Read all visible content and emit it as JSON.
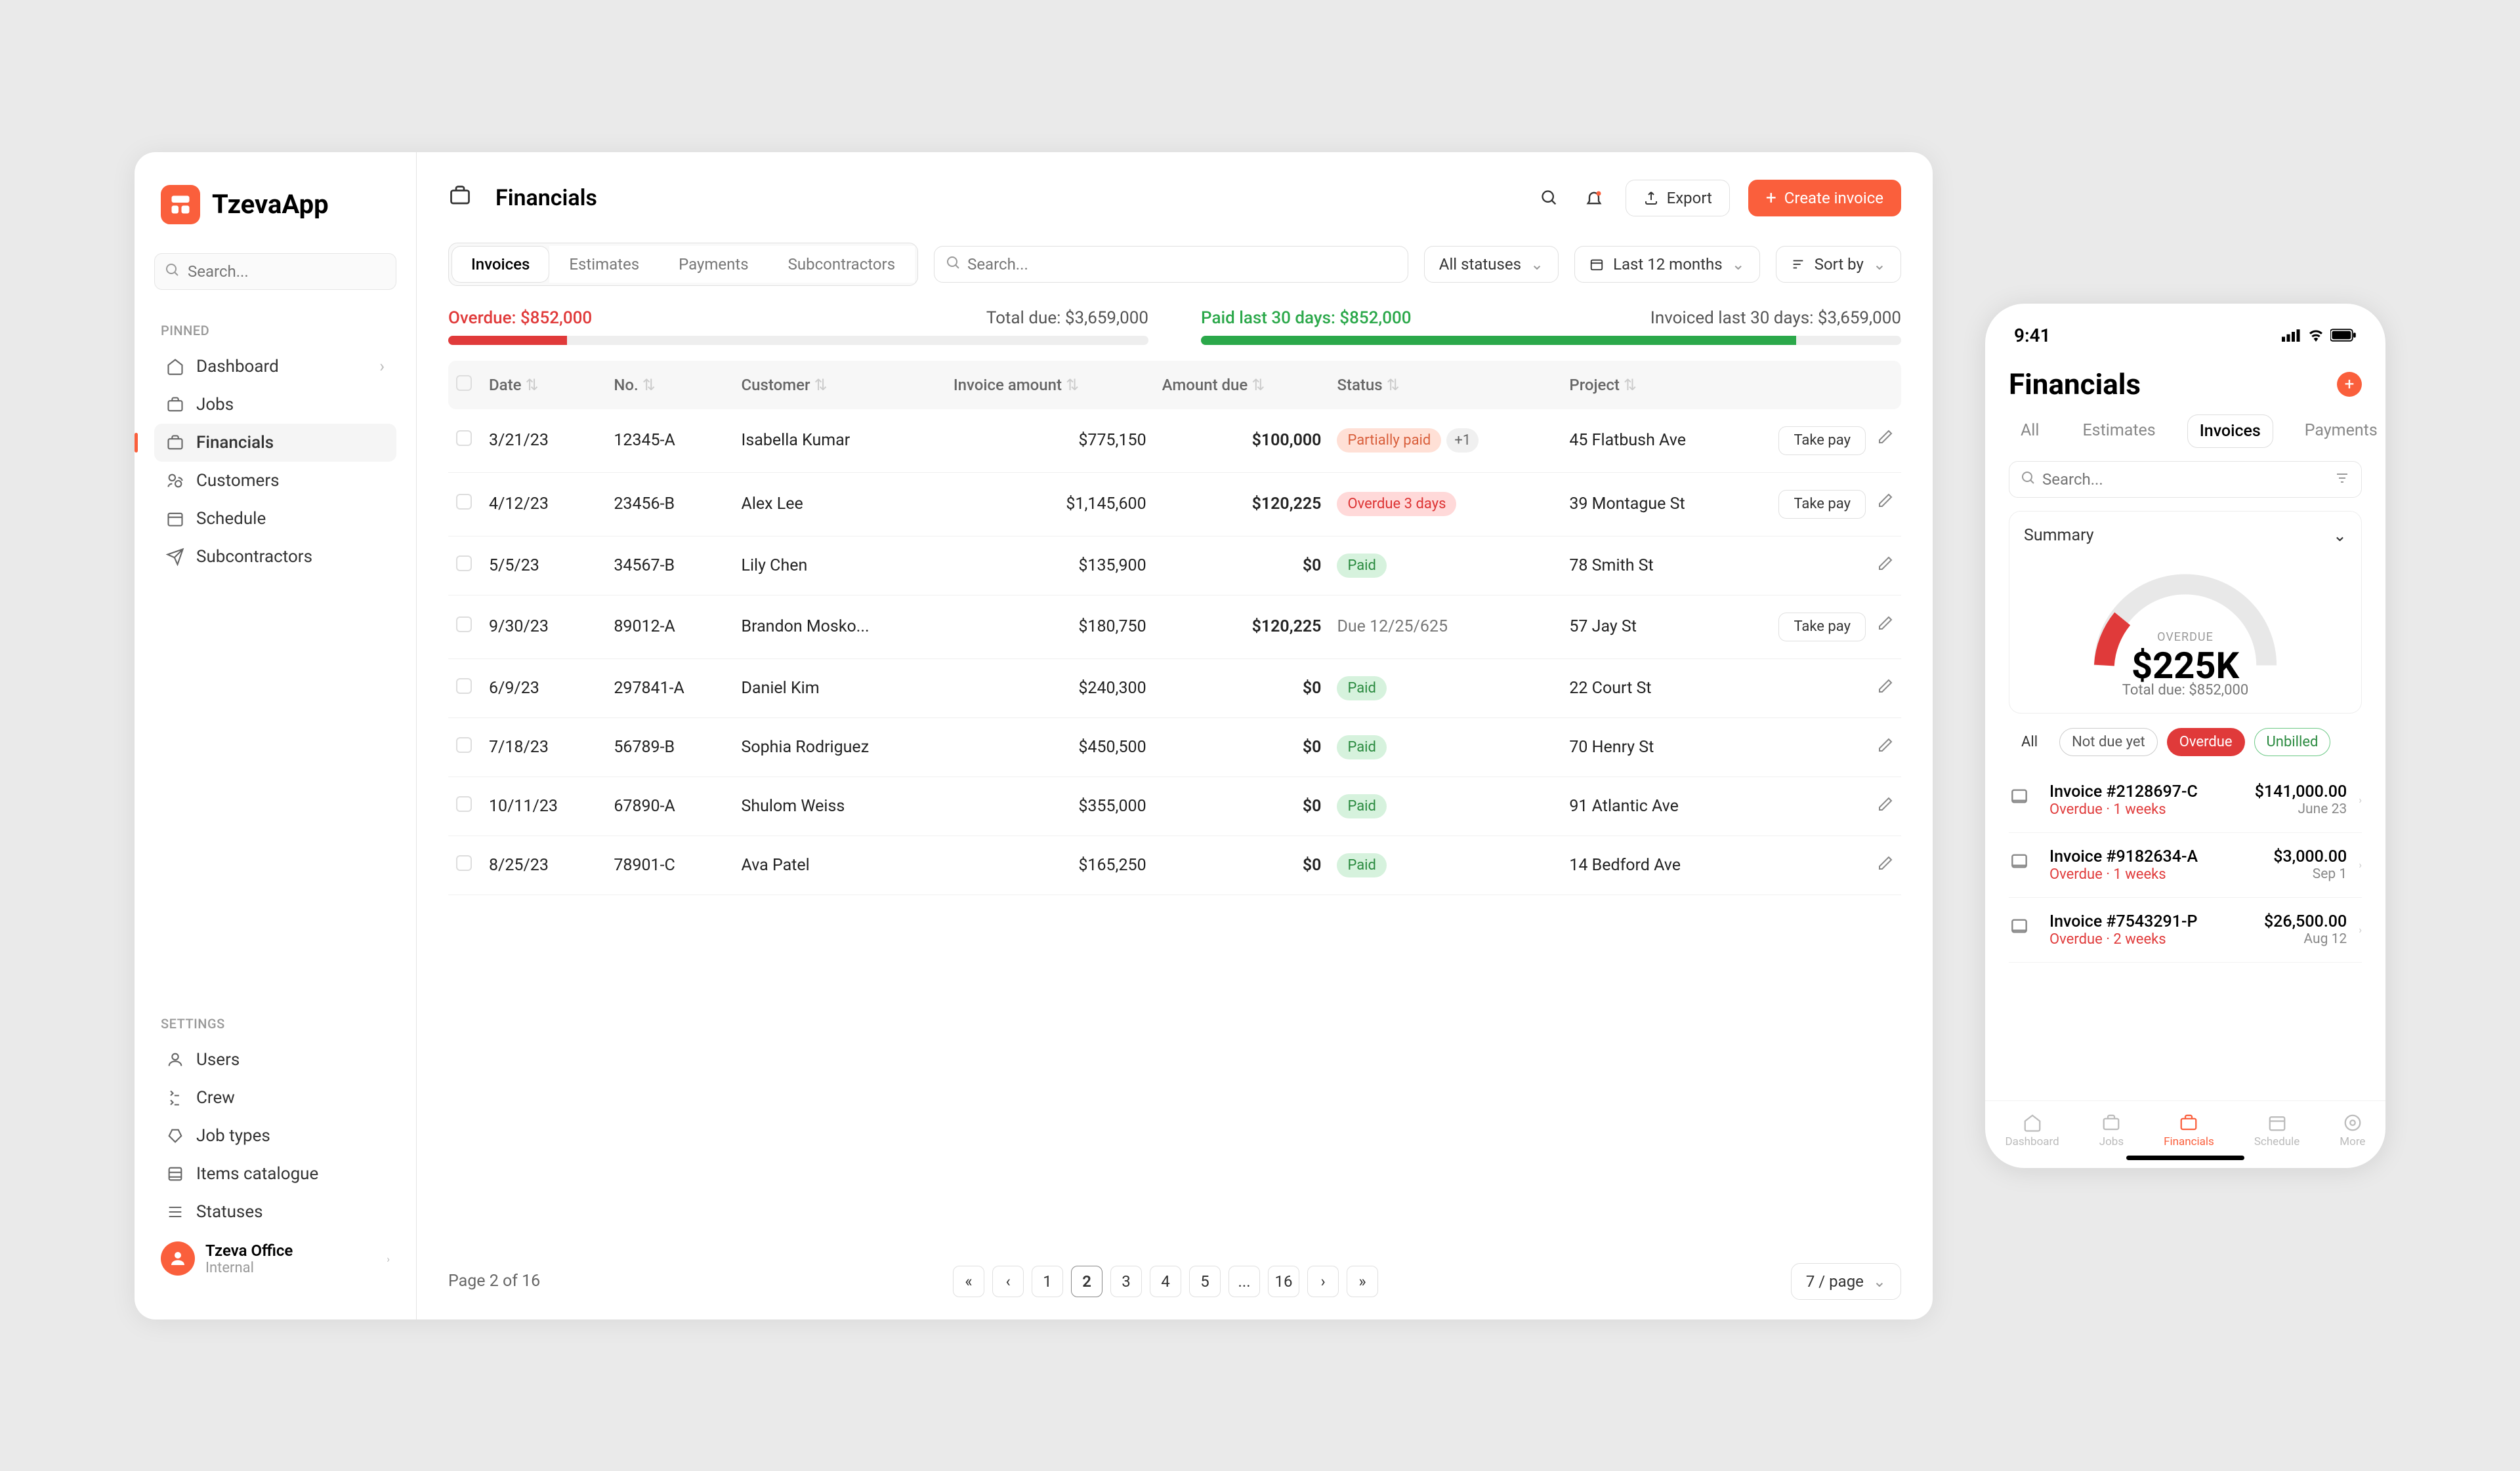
{
  "app": {
    "name": "TzevaApp"
  },
  "sidebar": {
    "search_placeholder": "Search...",
    "pinned_label": "PINNED",
    "settings_label": "SETTINGS",
    "pinned": [
      "Dashboard",
      "Jobs",
      "Financials",
      "Customers",
      "Schedule",
      "Subcontractors"
    ],
    "settings": [
      "Users",
      "Crew",
      "Job types",
      "Items catalogue",
      "Statuses"
    ],
    "account": {
      "name": "Tzeva Office",
      "sub": "Internal"
    }
  },
  "header": {
    "title": "Financials",
    "export": "Export",
    "create": "Create invoice"
  },
  "toolbar": {
    "tabs": [
      "Invoices",
      "Estimates",
      "Payments",
      "Subcontractors"
    ],
    "search_placeholder": "Search...",
    "status_filter": "All statuses",
    "date_filter": "Last 12 months",
    "sort": "Sort by"
  },
  "summary": {
    "overdue_label": "Overdue:",
    "overdue_amount": "$852,000",
    "total_due_label": "Total due:",
    "total_due_amount": "$3,659,000",
    "paid_label": "Paid last 30 days:",
    "paid_amount": "$852,000",
    "invoiced_label": "Invoiced last 30 days:",
    "invoiced_amount": "$3,659,000"
  },
  "table": {
    "headers": [
      "Date",
      "No.",
      "Customer",
      "Invoice amount",
      "Amount due",
      "Status",
      "Project"
    ],
    "take_pay": "Take pay",
    "rows": [
      {
        "date": "3/21/23",
        "no": "12345-A",
        "customer": "Isabella Kumar",
        "invoice": "$775,150",
        "due": "$100,000",
        "status": "Partially paid",
        "status_type": "partial",
        "extra": "+1",
        "project": "45 Flatbush Ave",
        "can_pay": true
      },
      {
        "date": "4/12/23",
        "no": "23456-B",
        "customer": "Alex Lee",
        "invoice": "$1,145,600",
        "due": "$120,225",
        "status": "Overdue 3 days",
        "status_type": "overdue",
        "project": "39 Montague St",
        "can_pay": true
      },
      {
        "date": "5/5/23",
        "no": "34567-B",
        "customer": "Lily Chen",
        "invoice": "$135,900",
        "due": "$0",
        "status": "Paid",
        "status_type": "paid",
        "project": "78 Smith St",
        "can_pay": false
      },
      {
        "date": "9/30/23",
        "no": "89012-A",
        "customer": "Brandon Mosko...",
        "invoice": "$180,750",
        "due": "$120,225",
        "status": "Due 12/25/625",
        "status_type": "due",
        "project": "57 Jay St",
        "can_pay": true
      },
      {
        "date": "6/9/23",
        "no": "297841-A",
        "customer": "Daniel Kim",
        "invoice": "$240,300",
        "due": "$0",
        "status": "Paid",
        "status_type": "paid",
        "project": "22 Court St",
        "can_pay": false
      },
      {
        "date": "7/18/23",
        "no": "56789-B",
        "customer": "Sophia Rodriguez",
        "invoice": "$450,500",
        "due": "$0",
        "status": "Paid",
        "status_type": "paid",
        "project": "70 Henry St",
        "can_pay": false
      },
      {
        "date": "10/11/23",
        "no": "67890-A",
        "customer": "Shulom Weiss",
        "invoice": "$355,000",
        "due": "$0",
        "status": "Paid",
        "status_type": "paid",
        "project": "91 Atlantic Ave",
        "can_pay": false
      },
      {
        "date": "8/25/23",
        "no": "78901-C",
        "customer": "Ava Patel",
        "invoice": "$165,250",
        "due": "$0",
        "status": "Paid",
        "status_type": "paid",
        "project": "14 Bedford Ave",
        "can_pay": false
      }
    ]
  },
  "footer": {
    "page_text": "Page 2 of 16",
    "pages": [
      "1",
      "2",
      "3",
      "4",
      "5",
      "...",
      "16"
    ],
    "per_page": "7 / page"
  },
  "mobile": {
    "time": "9:41",
    "title": "Financials",
    "tabs": [
      "All",
      "Estimates",
      "Invoices",
      "Payments"
    ],
    "search_placeholder": "Search...",
    "summary_label": "Summary",
    "gauge_label": "OVERDUE",
    "gauge_amount": "$225K",
    "total_due": "Total due: $852,000",
    "chips": [
      "All",
      "Not due yet",
      "Overdue",
      "Unbilled"
    ],
    "items": [
      {
        "title": "Invoice #2128697-C",
        "sub": "Overdue · 1 weeks",
        "amount": "$141,000.00",
        "date": "June 23"
      },
      {
        "title": "Invoice #9182634-A",
        "sub": "Overdue · 1 weeks",
        "amount": "$3,000.00",
        "date": "Sep 1"
      },
      {
        "title": "Invoice #7543291-P",
        "sub": "Overdue · 2 weeks",
        "amount": "$26,500.00",
        "date": "Aug 12"
      }
    ],
    "nav": [
      "Dashboard",
      "Jobs",
      "Financials",
      "Schedule",
      "More"
    ]
  }
}
